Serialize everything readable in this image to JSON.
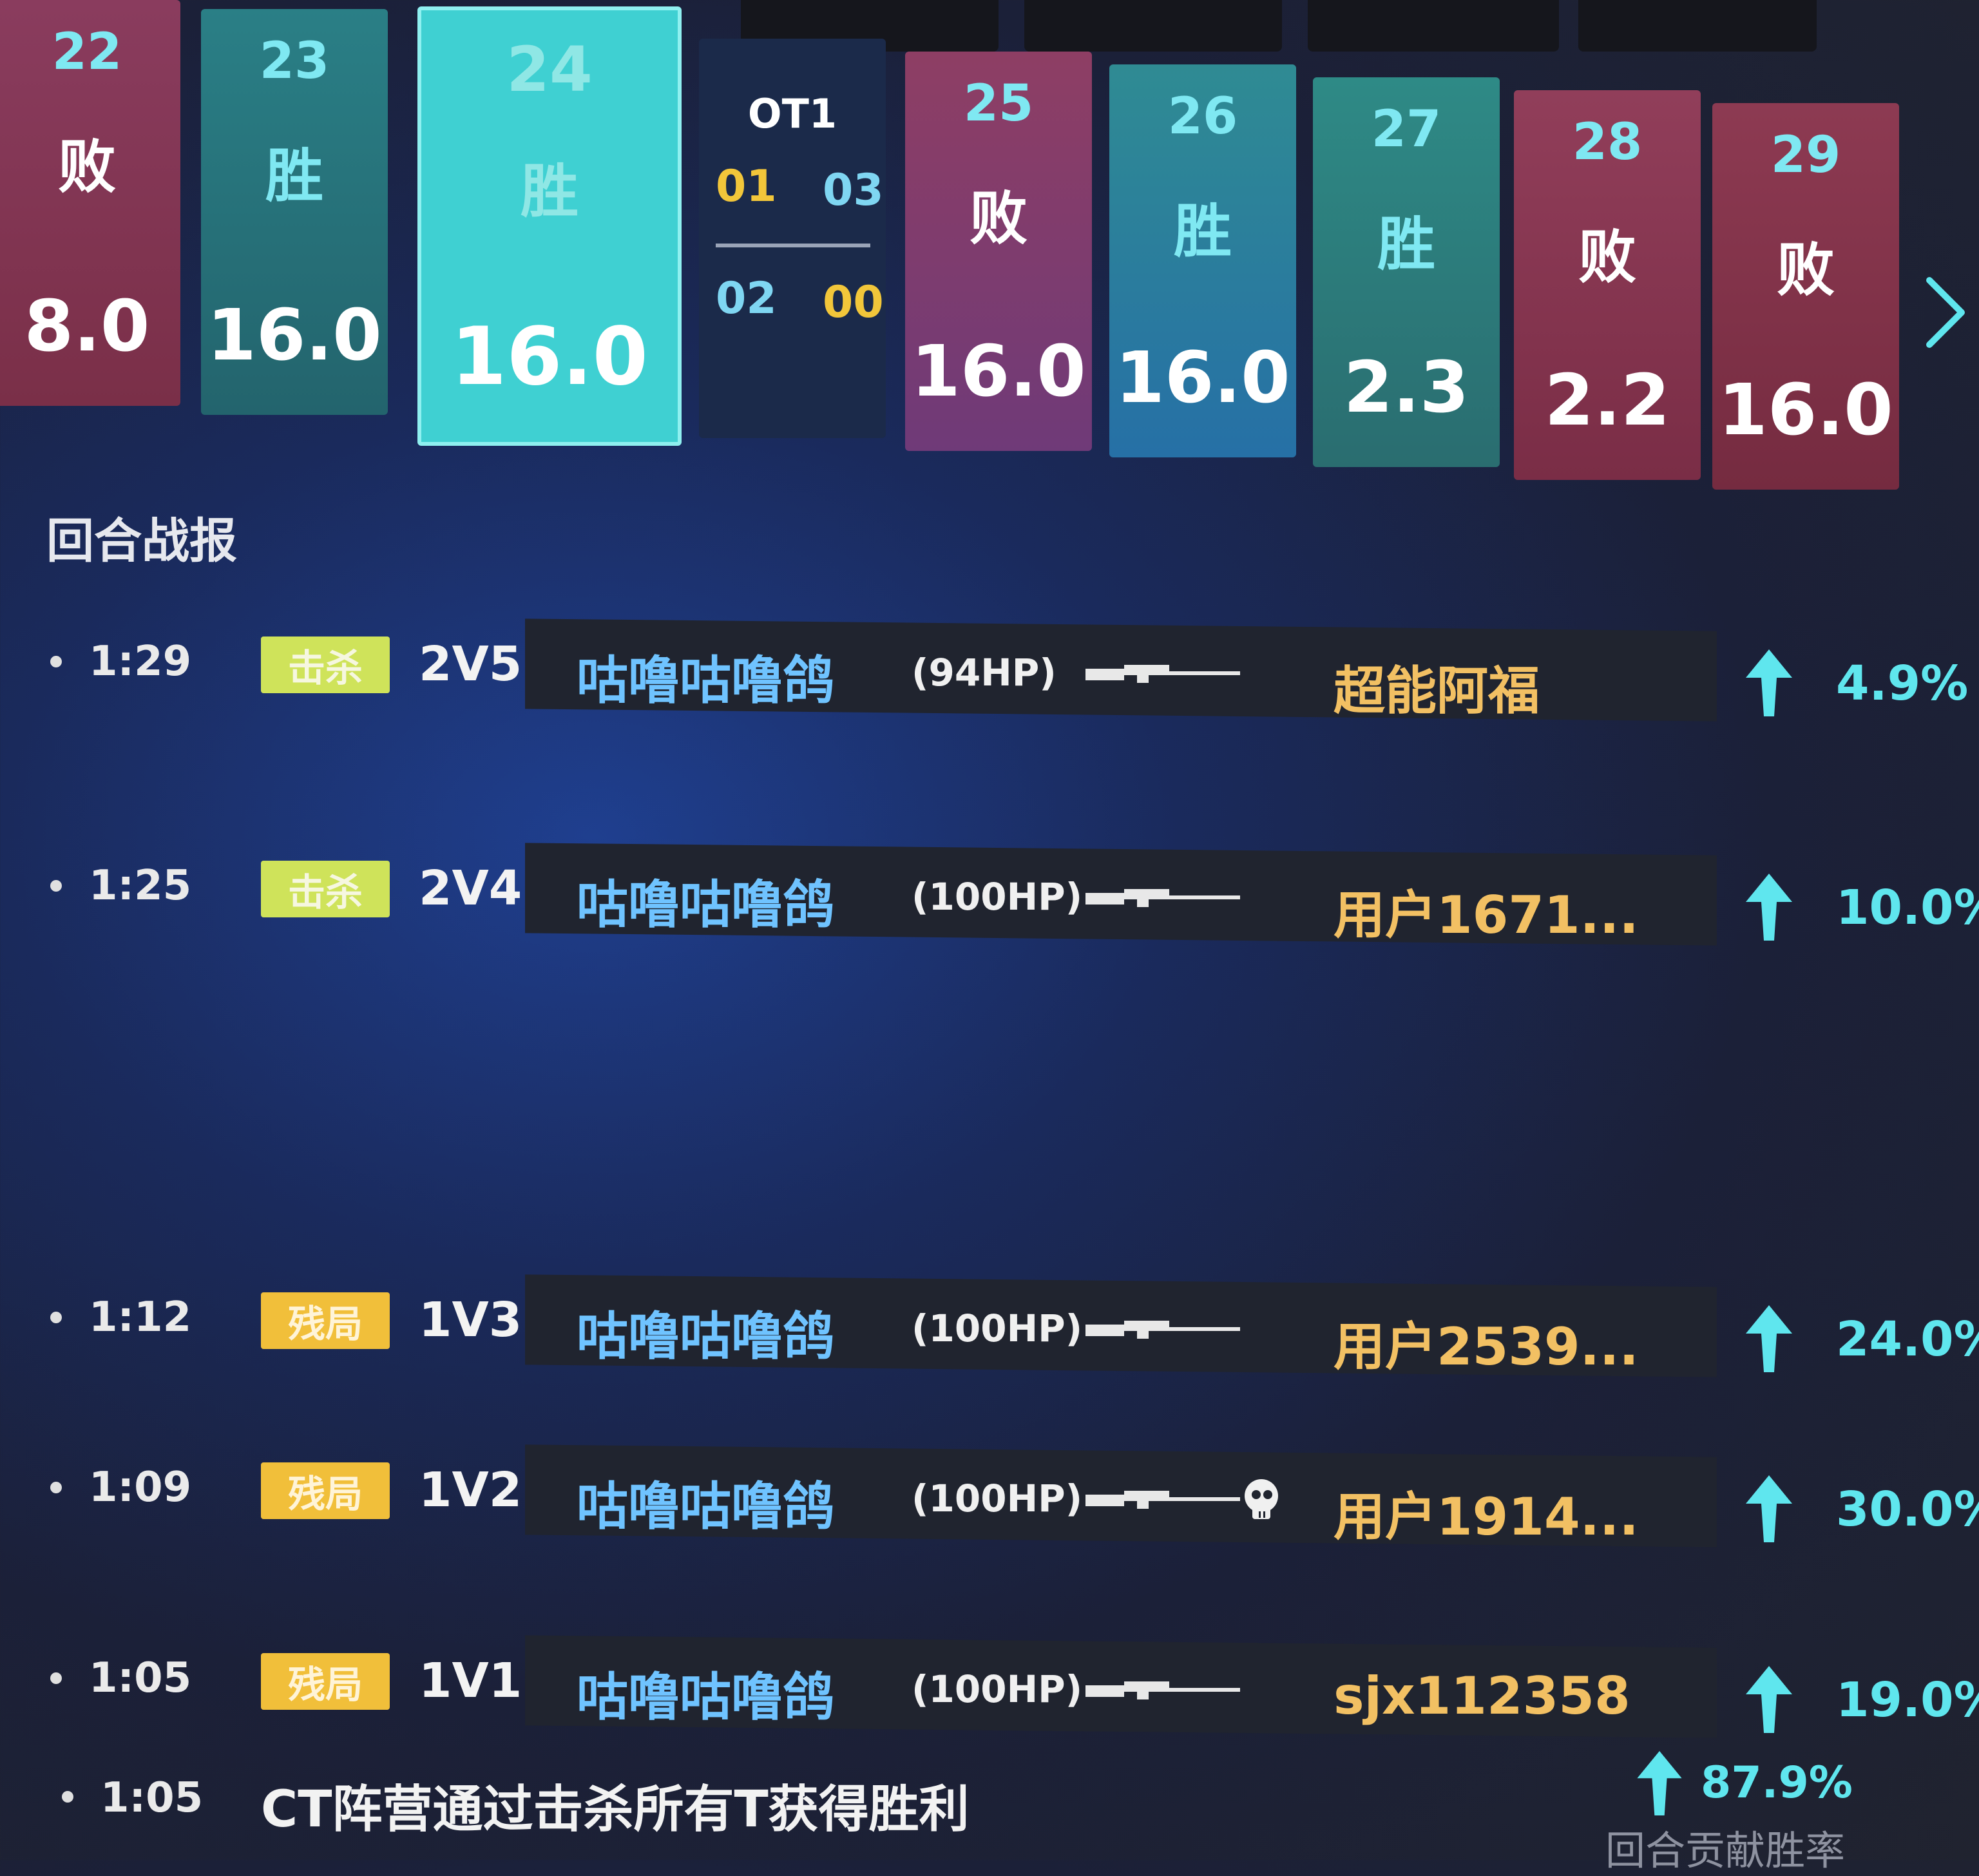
{
  "rounds": [
    {
      "num": "22",
      "result": "败",
      "value": "8.0",
      "type": "loss"
    },
    {
      "num": "23",
      "result": "胜",
      "value": "16.0",
      "type": "win"
    },
    {
      "num": "24",
      "result": "胜",
      "value": "16.0",
      "type": "selected"
    },
    {
      "num": "25",
      "result": "败",
      "value": "16.0",
      "type": "loss"
    },
    {
      "num": "26",
      "result": "胜",
      "value": "16.0",
      "type": "win"
    },
    {
      "num": "27",
      "result": "胜",
      "value": "2.3",
      "type": "win"
    },
    {
      "num": "28",
      "result": "败",
      "value": "2.2",
      "type": "loss"
    },
    {
      "num": "29",
      "result": "败",
      "value": "16.0",
      "type": "loss"
    }
  ],
  "overtime": {
    "title": "OT1",
    "top_left": "01",
    "top_right": "03",
    "bottom_left": "02",
    "bottom_right": "00"
  },
  "section_title": "回合战报",
  "events": [
    {
      "time": "1:29",
      "tag": "击杀",
      "tag_type": "kill",
      "situation": "2V5",
      "killer": "咕噜咕噜鸽",
      "hp": "(94HP)",
      "victim": "超能阿福",
      "headshot": false,
      "pct": "4.9%"
    },
    {
      "time": "1:25",
      "tag": "击杀",
      "tag_type": "kill",
      "situation": "2V4",
      "killer": "咕噜咕噜鸽",
      "hp": "(100HP)",
      "victim": "用户1671...",
      "headshot": false,
      "pct": "10.0%"
    },
    {
      "time": "1:12",
      "tag": "残局",
      "tag_type": "clutch",
      "situation": "1V3",
      "killer": "咕噜咕噜鸽",
      "hp": "(100HP)",
      "victim": "用户2539...",
      "headshot": false,
      "pct": "24.0%"
    },
    {
      "time": "1:09",
      "tag": "残局",
      "tag_type": "clutch",
      "situation": "1V2",
      "killer": "咕噜咕噜鸽",
      "hp": "(100HP)",
      "victim": "用户1914...",
      "headshot": true,
      "pct": "30.0%"
    },
    {
      "time": "1:05",
      "tag": "残局",
      "tag_type": "clutch",
      "situation": "1V1",
      "killer": "咕噜咕噜鸽",
      "hp": "(100HP)",
      "victim": "sjx112358",
      "headshot": false,
      "pct": "19.0%"
    }
  ],
  "final": {
    "time": "1:05",
    "message": "CT阵营通过击杀所有T获得胜利",
    "pct": "87.9%"
  },
  "footer_label": "回合贡献胜率",
  "icons": {
    "next": "chevron-right-icon",
    "weapon": "sniper-rifle-icon",
    "headshot": "skull-icon",
    "increase": "up-arrow-icon"
  },
  "colors": {
    "win": "#2a7f86",
    "loss": "#8a3c5e",
    "selected": "#3fd0d2",
    "kill_tag": "#cfe35a",
    "clutch_tag": "#f1bf3a",
    "pct": "#5fe6ee",
    "killer": "#6fc3ff",
    "victim": "#f2c063"
  }
}
